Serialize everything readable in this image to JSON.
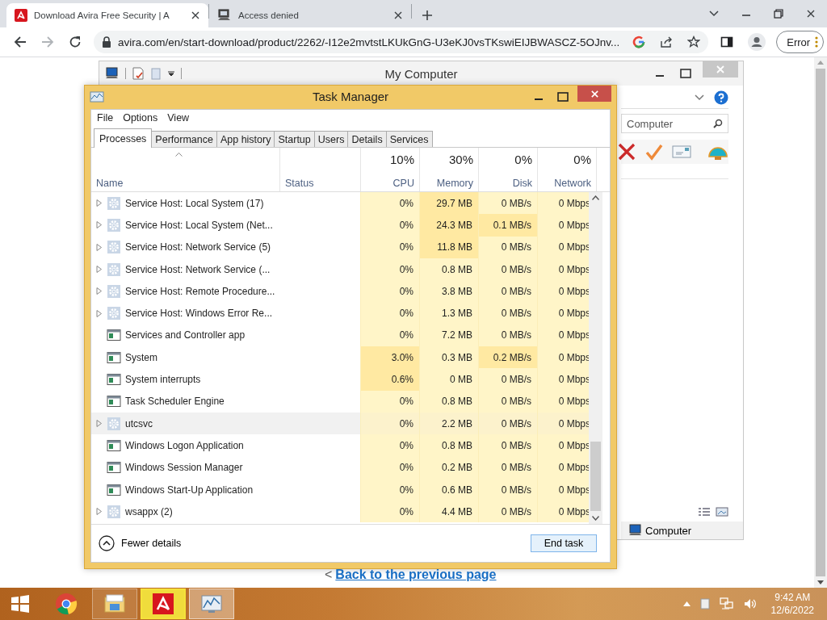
{
  "browser": {
    "tabs": [
      {
        "title": "Download Avira Free Security | A",
        "kind": "avira",
        "selected": true
      },
      {
        "title": "Access denied",
        "kind": "computer",
        "selected": false
      }
    ],
    "url": "avira.com/en/start-download/product/2262/-I12e2mvtstLKUkGnG-U3eKJ0vsTKswiEIJBWASCZ-5OJnv...",
    "profile_button": "Error"
  },
  "page": {
    "link_prefix": "<",
    "link": "Back to the previous page"
  },
  "explorer": {
    "title": "My Computer",
    "search_placeholder": "Computer",
    "status_item": "Computer"
  },
  "task_manager": {
    "title": "Task Manager",
    "menu": [
      "File",
      "Options",
      "View"
    ],
    "tabs": [
      {
        "label": "Processes",
        "selected": true
      },
      {
        "label": "Performance",
        "selected": false
      },
      {
        "label": "App history",
        "selected": false
      },
      {
        "label": "Startup",
        "selected": false
      },
      {
        "label": "Users",
        "selected": false
      },
      {
        "label": "Details",
        "selected": false
      },
      {
        "label": "Services",
        "selected": false
      }
    ],
    "name_header": {
      "label": "Name",
      "sorted": true
    },
    "status_header": "Status",
    "columns": [
      {
        "label": "CPU",
        "usage": "10%"
      },
      {
        "label": "Memory",
        "usage": "30%"
      },
      {
        "label": "Disk",
        "usage": "0%"
      },
      {
        "label": "Network",
        "usage": "0%"
      }
    ],
    "rows": [
      {
        "name": "Service Host: Local System (17)",
        "kind": "gear",
        "expandable": true,
        "selected": false,
        "cells": [
          {
            "text": "0%",
            "hot": false
          },
          {
            "text": "29.7 MB",
            "hot": true
          },
          {
            "text": "0 MB/s",
            "hot": false
          },
          {
            "text": "0 Mbps",
            "hot": false
          }
        ]
      },
      {
        "name": "Service Host: Local System (Net...",
        "kind": "gear",
        "expandable": true,
        "selected": false,
        "cells": [
          {
            "text": "0%",
            "hot": false
          },
          {
            "text": "24.3 MB",
            "hot": true
          },
          {
            "text": "0.1 MB/s",
            "hot": true
          },
          {
            "text": "0 Mbps",
            "hot": false
          }
        ]
      },
      {
        "name": "Service Host: Network Service (5)",
        "kind": "gear",
        "expandable": true,
        "selected": false,
        "cells": [
          {
            "text": "0%",
            "hot": false
          },
          {
            "text": "11.8 MB",
            "hot": true
          },
          {
            "text": "0 MB/s",
            "hot": false
          },
          {
            "text": "0 Mbps",
            "hot": false
          }
        ]
      },
      {
        "name": "Service Host: Network Service (...",
        "kind": "gear",
        "expandable": true,
        "selected": false,
        "cells": [
          {
            "text": "0%",
            "hot": false
          },
          {
            "text": "0.8 MB",
            "hot": false
          },
          {
            "text": "0 MB/s",
            "hot": false
          },
          {
            "text": "0 Mbps",
            "hot": false
          }
        ]
      },
      {
        "name": "Service Host: Remote Procedure...",
        "kind": "gear",
        "expandable": true,
        "selected": false,
        "cells": [
          {
            "text": "0%",
            "hot": false
          },
          {
            "text": "3.8 MB",
            "hot": false
          },
          {
            "text": "0 MB/s",
            "hot": false
          },
          {
            "text": "0 Mbps",
            "hot": false
          }
        ]
      },
      {
        "name": "Service Host: Windows Error Re...",
        "kind": "gear",
        "expandable": true,
        "selected": false,
        "cells": [
          {
            "text": "0%",
            "hot": false
          },
          {
            "text": "1.3 MB",
            "hot": false
          },
          {
            "text": "0 MB/s",
            "hot": false
          },
          {
            "text": "0 Mbps",
            "hot": false
          }
        ]
      },
      {
        "name": "Services and Controller app",
        "kind": "app",
        "expandable": false,
        "selected": false,
        "cells": [
          {
            "text": "0%",
            "hot": false
          },
          {
            "text": "7.2 MB",
            "hot": false
          },
          {
            "text": "0 MB/s",
            "hot": false
          },
          {
            "text": "0 Mbps",
            "hot": false
          }
        ]
      },
      {
        "name": "System",
        "kind": "app",
        "expandable": false,
        "selected": false,
        "cells": [
          {
            "text": "3.0%",
            "hot": true
          },
          {
            "text": "0.3 MB",
            "hot": false
          },
          {
            "text": "0.2 MB/s",
            "hot": true
          },
          {
            "text": "0 Mbps",
            "hot": false
          }
        ]
      },
      {
        "name": "System interrupts",
        "kind": "app",
        "expandable": false,
        "selected": false,
        "cells": [
          {
            "text": "0.6%",
            "hot": true
          },
          {
            "text": "0 MB",
            "hot": false
          },
          {
            "text": "0 MB/s",
            "hot": false
          },
          {
            "text": "0 Mbps",
            "hot": false
          }
        ]
      },
      {
        "name": "Task Scheduler Engine",
        "kind": "app",
        "expandable": false,
        "selected": false,
        "cells": [
          {
            "text": "0%",
            "hot": false
          },
          {
            "text": "0.8 MB",
            "hot": false
          },
          {
            "text": "0 MB/s",
            "hot": false
          },
          {
            "text": "0 Mbps",
            "hot": false
          }
        ]
      },
      {
        "name": "utcsvc",
        "kind": "gear",
        "expandable": true,
        "selected": true,
        "cells": [
          {
            "text": "0%",
            "hot": false
          },
          {
            "text": "2.2 MB",
            "hot": false
          },
          {
            "text": "0 MB/s",
            "hot": false
          },
          {
            "text": "0 Mbps",
            "hot": false
          }
        ]
      },
      {
        "name": "Windows Logon Application",
        "kind": "app",
        "expandable": false,
        "selected": false,
        "cells": [
          {
            "text": "0%",
            "hot": false
          },
          {
            "text": "0.8 MB",
            "hot": false
          },
          {
            "text": "0 MB/s",
            "hot": false
          },
          {
            "text": "0 Mbps",
            "hot": false
          }
        ]
      },
      {
        "name": "Windows Session Manager",
        "kind": "app",
        "expandable": false,
        "selected": false,
        "cells": [
          {
            "text": "0%",
            "hot": false
          },
          {
            "text": "0.2 MB",
            "hot": false
          },
          {
            "text": "0 MB/s",
            "hot": false
          },
          {
            "text": "0 Mbps",
            "hot": false
          }
        ]
      },
      {
        "name": "Windows Start-Up Application",
        "kind": "app",
        "expandable": false,
        "selected": false,
        "cells": [
          {
            "text": "0%",
            "hot": false
          },
          {
            "text": "0.6 MB",
            "hot": false
          },
          {
            "text": "0 MB/s",
            "hot": false
          },
          {
            "text": "0 Mbps",
            "hot": false
          }
        ]
      },
      {
        "name": "wsappx (2)",
        "kind": "gear",
        "expandable": true,
        "selected": false,
        "cells": [
          {
            "text": "0%",
            "hot": false
          },
          {
            "text": "4.4 MB",
            "hot": false
          },
          {
            "text": "0 MB/s",
            "hot": false
          },
          {
            "text": "0 Mbps",
            "hot": false
          }
        ]
      }
    ],
    "details_toggle": "Fewer details",
    "end_button": "End task"
  },
  "taskbar": {
    "apps": [
      {
        "kind": "chrome",
        "running": false,
        "selected": false,
        "attention": false
      },
      {
        "kind": "explorer",
        "running": true,
        "selected": false,
        "attention": false
      },
      {
        "kind": "avira",
        "running": true,
        "selected": false,
        "attention": true
      },
      {
        "kind": "taskmanager",
        "running": true,
        "selected": true,
        "attention": false
      }
    ],
    "time": "9:42 AM",
    "date": "12/6/2022"
  }
}
